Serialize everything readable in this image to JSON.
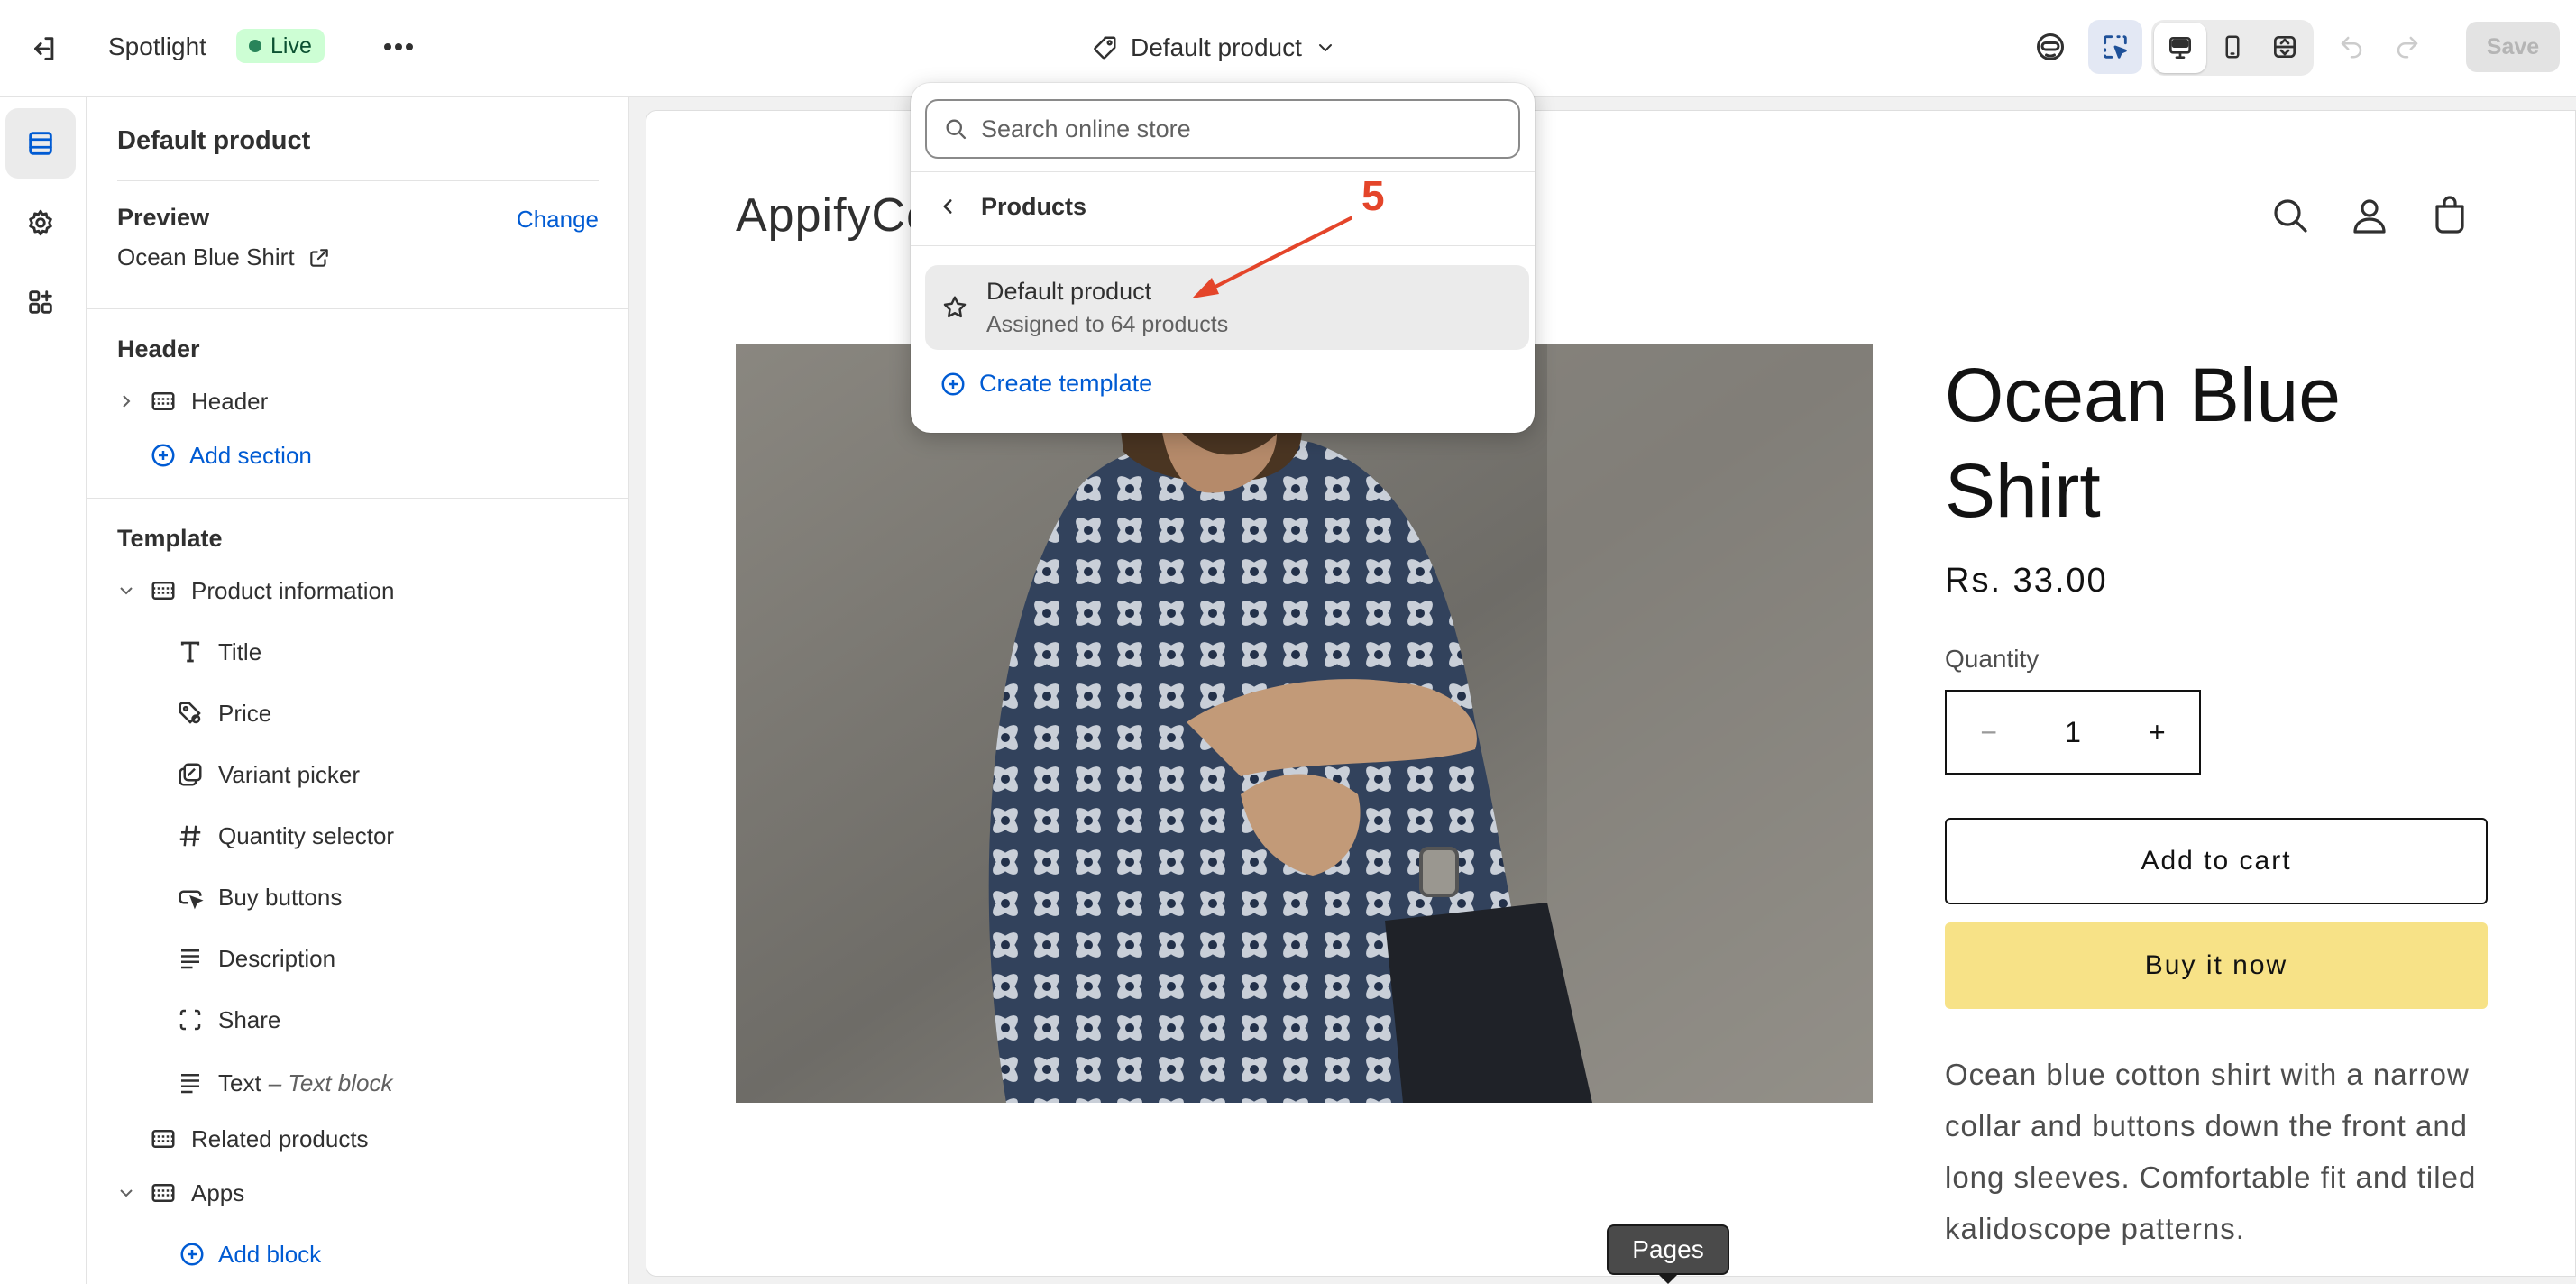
{
  "topbar": {
    "app_name": "Spotlight",
    "status_badge": "Live",
    "template_name": "Default product",
    "save_label": "Save",
    "colors": {
      "badge_bg": "#cdfed4",
      "badge_dot": "#29845a"
    }
  },
  "sidebar": {
    "title": "Default product",
    "preview_heading": "Preview",
    "preview_change": "Change",
    "preview_product": "Ocean Blue Shirt",
    "header_heading": "Header",
    "header_section": "Header",
    "add_section": "Add section",
    "template_heading": "Template",
    "product_information": "Product information",
    "blocks": [
      {
        "label": "Title",
        "icon": "title-icon"
      },
      {
        "label": "Price",
        "icon": "price-tag-icon"
      },
      {
        "label": "Variant picker",
        "icon": "variant-picker-icon"
      },
      {
        "label": "Quantity selector",
        "icon": "hash-icon"
      },
      {
        "label": "Buy buttons",
        "icon": "buy-button-icon"
      },
      {
        "label": "Description",
        "icon": "text-lines-icon"
      },
      {
        "label": "Share",
        "icon": "share-icon"
      }
    ],
    "text_block_label": "Text",
    "text_block_sub": "– Text block",
    "related_products": "Related products",
    "apps": "Apps",
    "add_block": "Add block"
  },
  "dropdown": {
    "search_placeholder": "Search online store",
    "back_label": "Products",
    "item_title": "Default product",
    "item_subtitle": "Assigned to 64 products",
    "create_label": "Create template"
  },
  "annotation": {
    "number": "5",
    "color": "#e4452a"
  },
  "preview": {
    "store_logo": "AppifyCo",
    "product_title": "Ocean Blue Shirt",
    "price": "Rs. 33.00",
    "quantity_label": "Quantity",
    "quantity_value": "1",
    "add_to_cart": "Add to cart",
    "buy_now": "Buy it now",
    "description": "Ocean blue cotton shirt with a narrow collar and buttons down the front and long sleeves. Comfortable fit and tiled kalidoscope patterns.",
    "buy_now_color": "#f7e287"
  },
  "tooltip": {
    "label": "Pages"
  }
}
